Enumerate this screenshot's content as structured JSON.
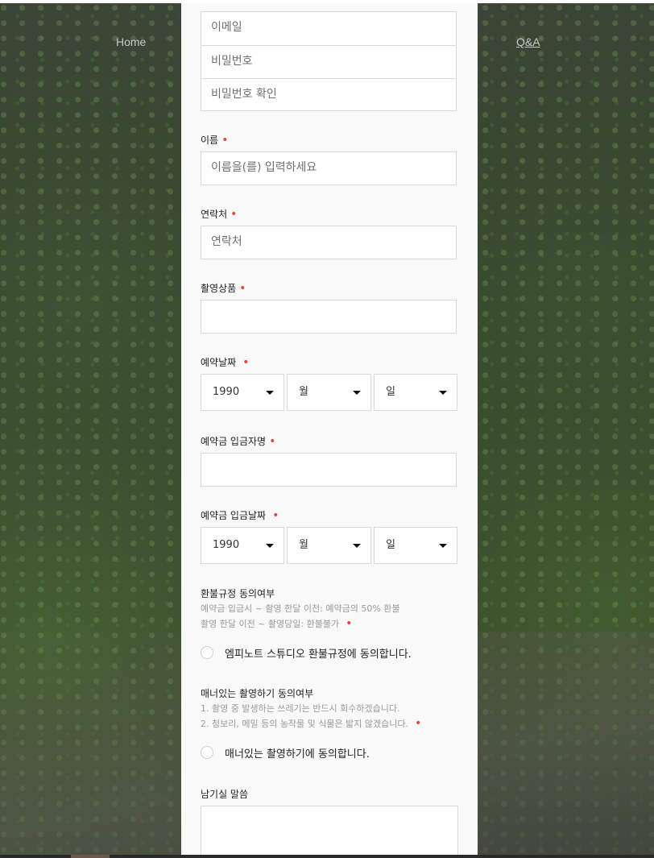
{
  "nav": {
    "home": "Home",
    "qa": "Q&A"
  },
  "form": {
    "email_placeholder": "이메일",
    "password_placeholder": "비밀번호",
    "password_confirm_placeholder": "비밀번호 확인",
    "name": {
      "label": "이름",
      "placeholder": "이름을(를) 입력하세요"
    },
    "phone": {
      "label": "연락처",
      "placeholder": "연락처"
    },
    "product": {
      "label": "촬영상품",
      "value": ""
    },
    "reservation_date": {
      "label": "예약날짜",
      "year": "1990",
      "month": "월",
      "day": "일"
    },
    "depositor": {
      "label": "예약금 입금자명",
      "value": ""
    },
    "deposit_date": {
      "label": "예약금 입금날짜",
      "year": "1990",
      "month": "월",
      "day": "일"
    },
    "refund": {
      "title": "환불규정 동의여부",
      "line1": "예약금 입금시 ~ 촬영 한달 이전: 예약금의 50% 환불",
      "line2": "촬영 한달 이전 ~ 촬영당일: 환불불가",
      "agree_label": "엠피노트 스튜디오 환불규정에 동의합니다."
    },
    "manners": {
      "title": "매너있는 촬영하기 동의여부",
      "line1": "1. 촬영 중 발생하는 쓰레기는 반드시 회수하겠습니다.",
      "line2": "2. 청보리, 메밀 등의 농작물 및 식물은 밟지 않겠습니다.",
      "agree_label": "매너있는 촬영하기에 동의합니다."
    },
    "message": {
      "label": "남기실 말씀",
      "value": ""
    },
    "required_mark": "•"
  },
  "colors": {
    "required": "#e84545",
    "panel": "#f9f9f9"
  }
}
